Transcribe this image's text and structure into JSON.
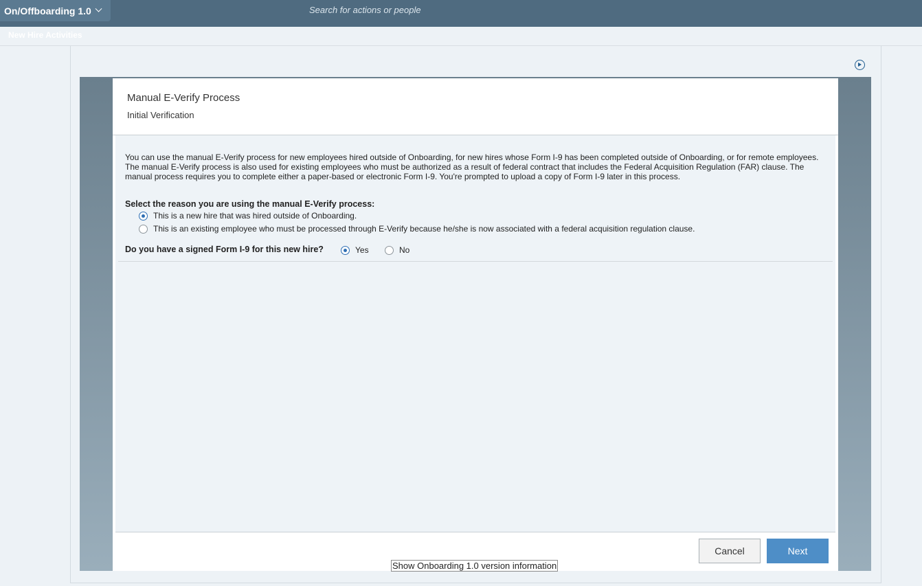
{
  "header": {
    "app_name": "On/Offboarding 1.0",
    "search_placeholder": "Search for actions or people"
  },
  "subheader": {
    "breadcrumb": "New Hire Activities"
  },
  "dialog": {
    "title": "Manual E-Verify Process",
    "subtitle": "Initial Verification",
    "description": "You can use the manual E-Verify process for new employees hired outside of Onboarding, for new hires whose Form I-9 has been completed outside of Onboarding, or for remote employees. The manual E-Verify process is also used for existing employees who must be authorized as a result of federal contract that includes the Federal Acquisition Regulation (FAR) clause. The manual process requires you to complete either a paper-based or electronic Form I-9. You're prompted to upload a copy of Form I-9 later in this process.",
    "reason_label": "Select the reason you are using the manual E-Verify process:",
    "reason_options": [
      {
        "label": "This is a new hire that was hired outside of Onboarding.",
        "selected": true
      },
      {
        "label": "This is an existing employee who must be processed through E-Verify because he/she is now associated with a federal acquisition regulation clause.",
        "selected": false
      }
    ],
    "i9_question": "Do you have a signed Form I-9 for this new hire?",
    "i9_options": [
      {
        "label": "Yes",
        "selected": true
      },
      {
        "label": "No",
        "selected": false
      }
    ],
    "cancel_label": "Cancel",
    "next_label": "Next"
  },
  "footer": {
    "version_link": "Show Onboarding 1.0 version information"
  },
  "icons": {
    "play": "play-circle-icon",
    "chevron": "chevron-down-icon"
  },
  "colors": {
    "header_bg": "#4f6b80",
    "accent": "#2f6fb4",
    "primary_button": "#4e8ec7"
  }
}
